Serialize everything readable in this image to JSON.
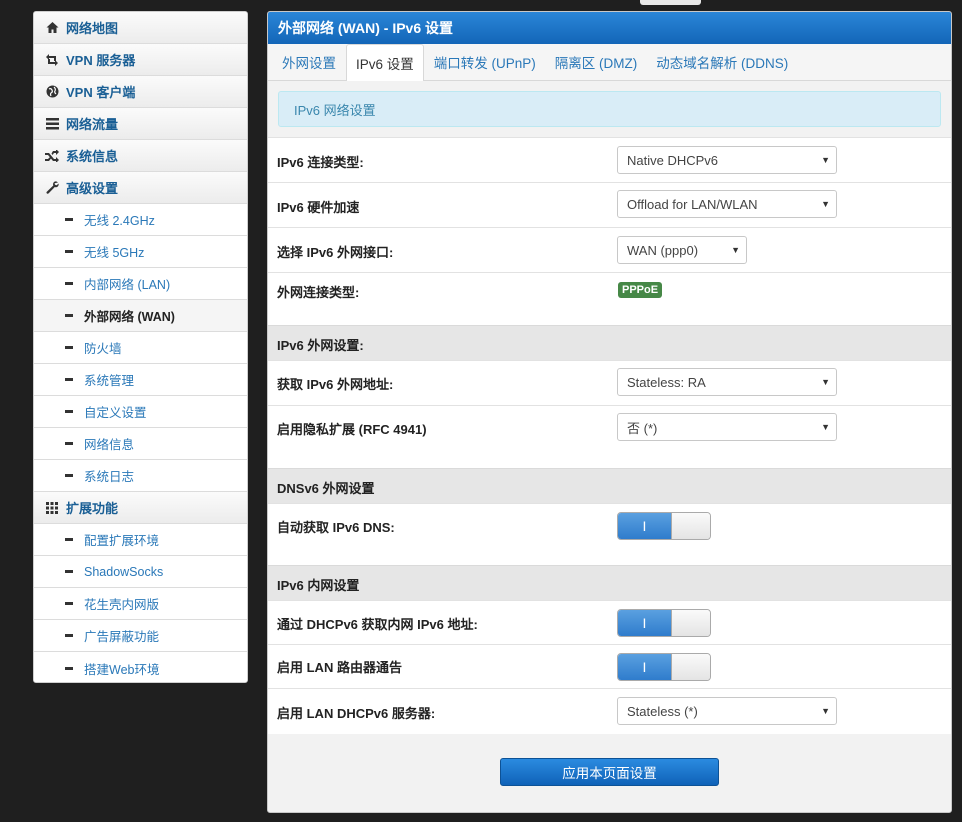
{
  "sidebar": {
    "items": [
      {
        "label": "网络地图",
        "type": "main",
        "icon": "home-icon"
      },
      {
        "label": "VPN 服务器",
        "type": "main",
        "icon": "retweet-icon"
      },
      {
        "label": "VPN 客户端",
        "type": "main",
        "icon": "globe-icon"
      },
      {
        "label": "网络流量",
        "type": "main",
        "icon": "list-icon"
      },
      {
        "label": "系统信息",
        "type": "main",
        "icon": "shuffle-icon"
      },
      {
        "label": "高级设置",
        "type": "main",
        "icon": "wrench-icon"
      },
      {
        "label": "无线 2.4GHz",
        "type": "sub"
      },
      {
        "label": "无线 5GHz",
        "type": "sub"
      },
      {
        "label": "内部网络 (LAN)",
        "type": "sub"
      },
      {
        "label": "外部网络 (WAN)",
        "type": "sub",
        "active": true
      },
      {
        "label": "防火墙",
        "type": "sub"
      },
      {
        "label": "系统管理",
        "type": "sub"
      },
      {
        "label": "自定义设置",
        "type": "sub"
      },
      {
        "label": "网络信息",
        "type": "sub"
      },
      {
        "label": "系统日志",
        "type": "sub"
      },
      {
        "label": "扩展功能",
        "type": "main",
        "icon": "grid-icon"
      },
      {
        "label": "配置扩展环境",
        "type": "sub"
      },
      {
        "label": "ShadowSocks",
        "type": "sub"
      },
      {
        "label": "花生壳内网版",
        "type": "sub"
      },
      {
        "label": "广告屏蔽功能",
        "type": "sub"
      },
      {
        "label": "搭建Web环境",
        "type": "sub"
      }
    ]
  },
  "panel": {
    "title": "外部网络 (WAN) - IPv6 设置",
    "tabs": [
      {
        "label": "外网设置"
      },
      {
        "label": "IPv6 设置",
        "active": true
      },
      {
        "label": "端口转发 (UPnP)"
      },
      {
        "label": "隔离区 (DMZ)"
      },
      {
        "label": "动态域名解析 (DDNS)"
      }
    ],
    "notice": "IPv6 网络设置"
  },
  "form": {
    "conn_type_label": "IPv6 连接类型:",
    "conn_type_value": "Native DHCPv6",
    "hw_accel_label": "IPv6 硬件加速",
    "hw_accel_value": "Offload for LAN/WLAN",
    "wan_if_label": "选择 IPv6 外网接口:",
    "wan_if_value": "WAN (ppp0)",
    "wan_conn_type_label": "外网连接类型:",
    "wan_conn_type_badge": "PPPoE",
    "section_wan": "IPv6 外网设置:",
    "get_addr_label": "获取 IPv6 外网地址:",
    "get_addr_value": "Stateless: RA",
    "privacy_label": "启用隐私扩展 (RFC 4941)",
    "privacy_value": "否 (*)",
    "section_dns": "DNSv6 外网设置",
    "auto_dns_label": "自动获取 IPv6 DNS:",
    "section_lan": "IPv6 内网设置",
    "dhcpv6_addr_label": "通过 DHCPv6 获取内网 IPv6 地址:",
    "lan_ra_label": "启用 LAN 路由器通告",
    "lan_dhcp_label": "启用 LAN DHCPv6 服务器:",
    "lan_dhcp_value": "Stateless (*)",
    "toggle_on_glyph": "I",
    "apply_button": "应用本页面设置"
  },
  "colors": {
    "accent": "#1366b8",
    "badge": "#468847",
    "link": "#2a78b8"
  }
}
